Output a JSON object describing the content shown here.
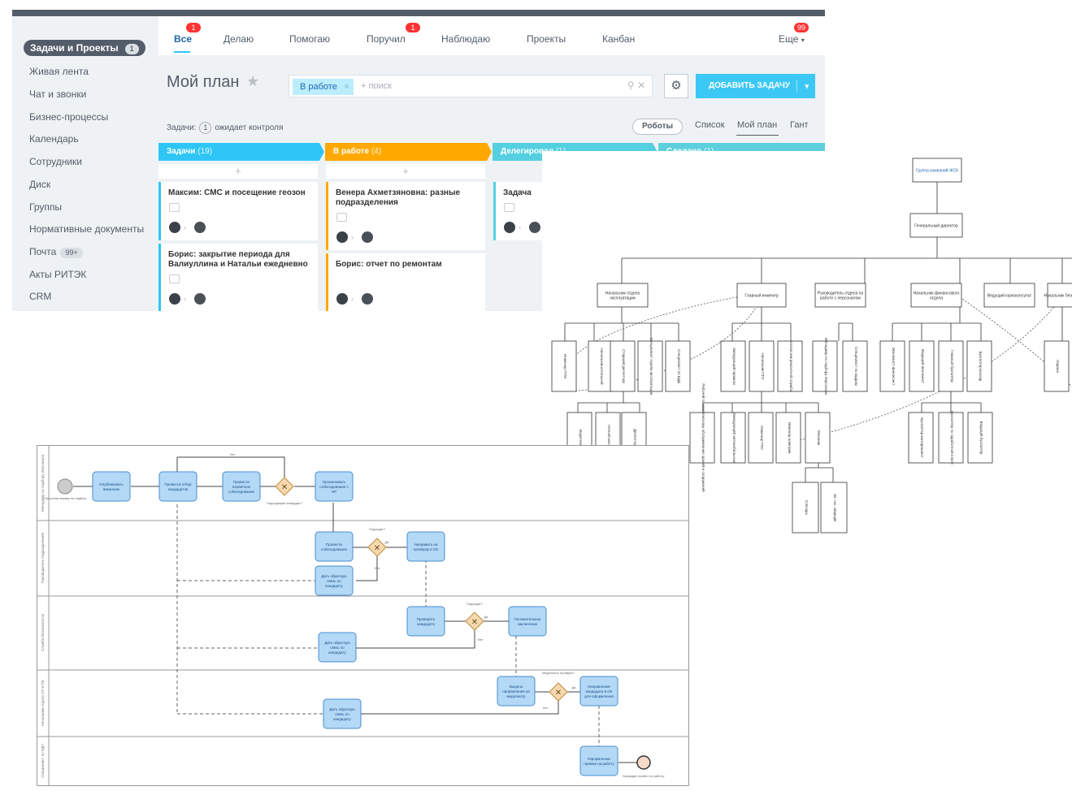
{
  "sidebar": {
    "items": [
      {
        "label": "Задачи и Проекты",
        "count": "1",
        "active": true
      },
      {
        "label": "Живая лента"
      },
      {
        "label": "Чат и звонки"
      },
      {
        "label": "Бизнес-процессы"
      },
      {
        "label": "Календарь"
      },
      {
        "label": "Сотрудники"
      },
      {
        "label": "Диск"
      },
      {
        "label": "Группы"
      },
      {
        "label": "Нормативные документы"
      },
      {
        "label": "Почта",
        "count": "99+"
      },
      {
        "label": "Акты РИТЭК"
      },
      {
        "label": "CRM"
      }
    ]
  },
  "tabs": [
    {
      "label": "Все",
      "badge": "1",
      "active": true
    },
    {
      "label": "Делаю"
    },
    {
      "label": "Помогаю"
    },
    {
      "label": "Поручил",
      "badge": "1"
    },
    {
      "label": "Наблюдаю"
    },
    {
      "label": "Проекты"
    },
    {
      "label": "Канбан"
    },
    {
      "label": "Еще",
      "badge": "99"
    }
  ],
  "page": {
    "title": "Мой план",
    "filter_chip": "В работе",
    "search_placeholder": "+ поиск",
    "add_button": "ДОБАВИТЬ ЗАДАЧУ",
    "tasks_prefix": "Задачи:",
    "tasks_count": "1",
    "tasks_suffix": "ожидает контроля",
    "robots_button": "Роботы",
    "views": [
      "Список",
      "Мой план",
      "Гант"
    ]
  },
  "kanban": {
    "columns": [
      {
        "name": "Задачи",
        "count": "(19)",
        "color": "#2fc6f6"
      },
      {
        "name": "В работе",
        "count": "(4)",
        "color": "#ffa900"
      },
      {
        "name": "Делегировал",
        "count": "(1)",
        "color": "#55d0e0"
      },
      {
        "name": "Сделано",
        "count": "(1)",
        "color": "#5ed0dd"
      }
    ],
    "cards": [
      {
        "title": "Максим: СМС и посещение геозон"
      },
      {
        "title": "Борис: закрытие периода для Валиуллина и Натальи ежедневно"
      },
      {
        "title": "Венера Ахметзяновна: разные подразделения"
      },
      {
        "title": "Борис: отчет по ремонтам"
      },
      {
        "title": "Задача"
      }
    ]
  },
  "org_chart": {
    "root": "Группа компаний ЖСК",
    "director": "Генеральный директор",
    "departments": [
      "Начальник отдела эксплуатации",
      "Главный инженер",
      "Руководитель отдела по работе с персоналом",
      "Начальник финансового отдела",
      "Ведущий юрисконсульт",
      "Начальник безопасн."
    ],
    "level2": [
      "Инженер ПТМ",
      "Начальник котельной",
      "Старший диспетчер",
      "Специалист отдела эксплуатации",
      "Специалист по БДД",
      "Заведующий гаражом",
      "Начальник ПТО",
      "Начальник ремонтной службы",
      "Менеджер по подбору персонала",
      "Специалист по кадрам",
      "Экономист-финансист",
      "Ведущий экономист",
      "Главный бухгалтер",
      "Бухгалтер-кассир",
      "Охрана"
    ],
    "level3": [
      "Водители",
      "Ночной мастер",
      "Диспетчер",
      "Рабочий по комплексному обслуживанию зданий и сооружений",
      "Заведующий автомобильным",
      "Инженер ПТО",
      "Инженер-электрик",
      "Механик",
      "Бухгалтер-материалист",
      "Бухгалтер по заработной плате",
      "Ведущий бухгалтер"
    ],
    "level4": [
      "Слесарь",
      "Эл. газ. сварщик"
    ]
  },
  "bpmn": {
    "lanes": [
      "Менеджер по подбору персонала",
      "Руководитель подразделения",
      "Служба безопасности",
      "Начальник отдела ОТ и ПБ",
      "Специалист по КДП"
    ],
    "tasks": [
      "Опубликовать вакансию",
      "Провести отбор кандидатов",
      "Провести первичное собеседование",
      "Организовать собеседование с НР",
      "Провести собеседование",
      "Направить на проверку в СБ",
      "Дать обратную связь по кандидату",
      "Проверить кандидата",
      "Положительное заключение",
      "Дать обратную связь по кандидату",
      "Выдача направления на медосмотр",
      "Направление кандидата в ОК для оформления",
      "Дать обратную связь по кандидату",
      "Оформление приема на работу"
    ],
    "start_label": "Получена заявка на подбор",
    "end_label": "Кандидат принят на работу",
    "gateway_labels": [
      "Подходящий кандидат?",
      "Подходит?",
      "Подходит?",
      "Медосмотр пройден?"
    ],
    "flow_labels": [
      "Нет",
      "Да",
      "Нет",
      "Да",
      "Нет",
      "Да",
      "Нет"
    ]
  }
}
